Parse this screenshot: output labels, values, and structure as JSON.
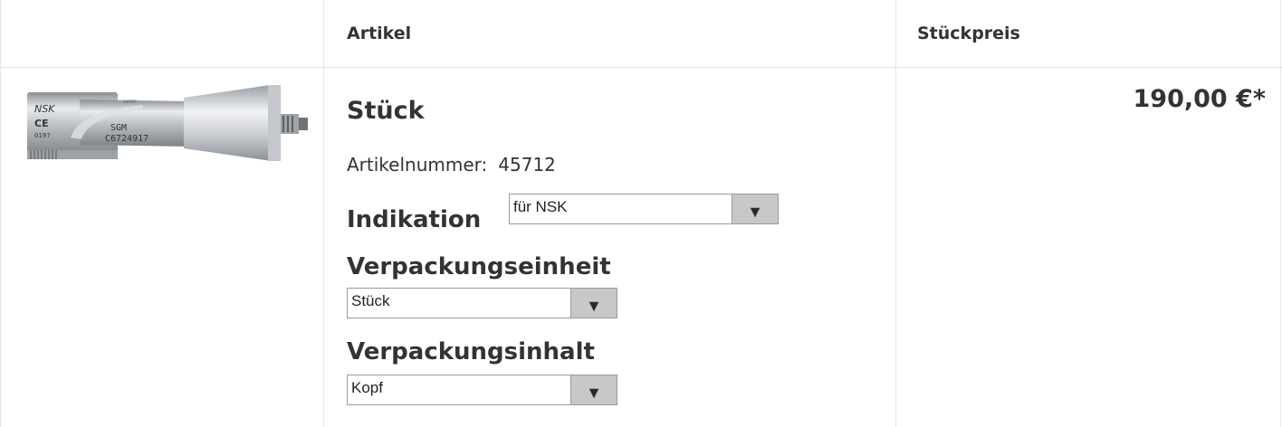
{
  "header": {
    "col_article": "Artikel",
    "col_price": "Stückpreis"
  },
  "product": {
    "title": "Stück",
    "article_number_label": "Artikelnummer:",
    "article_number": "45712",
    "price": "190,00 €*",
    "image": {
      "brand_text": "NSK",
      "ce_mark": "CE",
      "ce_number": "0197",
      "model_text": "SGM",
      "serial_text": "C6724917",
      "small_label": "SAFETY"
    }
  },
  "options": {
    "indikation": {
      "label": "Indikation",
      "selected": "für NSK"
    },
    "verpackungseinheit": {
      "label": "Verpackungseinheit",
      "selected": "Stück"
    },
    "verpackungsinhalt": {
      "label": "Verpackungsinhalt",
      "selected": "Kopf"
    }
  },
  "icons": {
    "dropdown_arrow": "▼"
  }
}
